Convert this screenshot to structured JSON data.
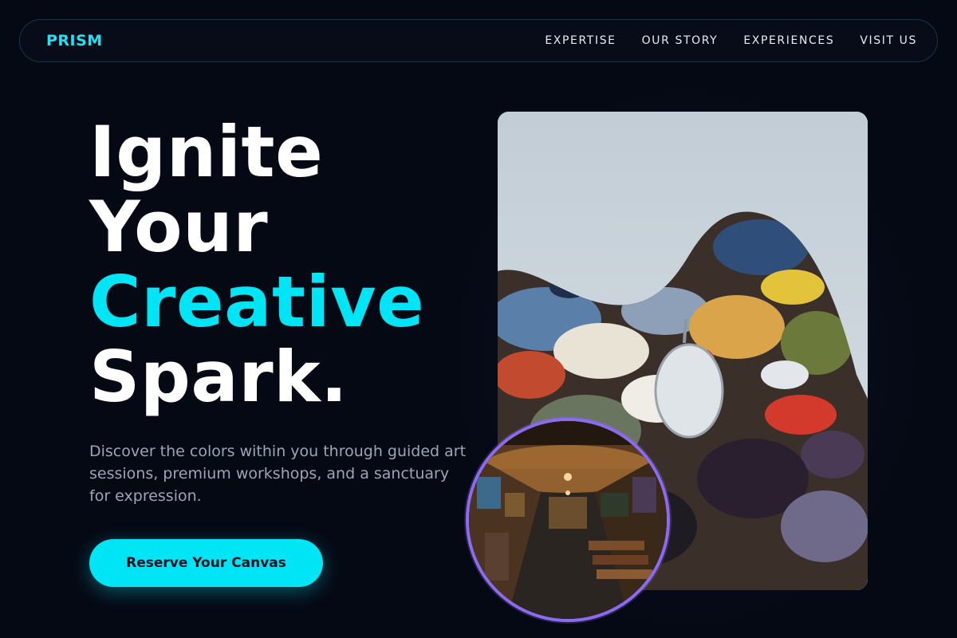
{
  "brand": {
    "name": "PRISM"
  },
  "nav": {
    "links": [
      {
        "label": "EXPERTISE"
      },
      {
        "label": "OUR STORY"
      },
      {
        "label": "EXPERIENCES"
      },
      {
        "label": "VISIT US"
      }
    ]
  },
  "hero": {
    "headline_line1": "Ignite",
    "headline_line2": "Your",
    "headline_line3": "Creative",
    "headline_line4": "Spark.",
    "subtitle": "Discover the colors within you through guided art sessions, premium workshops, and a sanctuary for expression.",
    "cta_label": "Reserve Your Canvas"
  },
  "colors": {
    "accent": "#00e5f5",
    "background": "#050914",
    "circle_border": "#8b6cf0"
  }
}
